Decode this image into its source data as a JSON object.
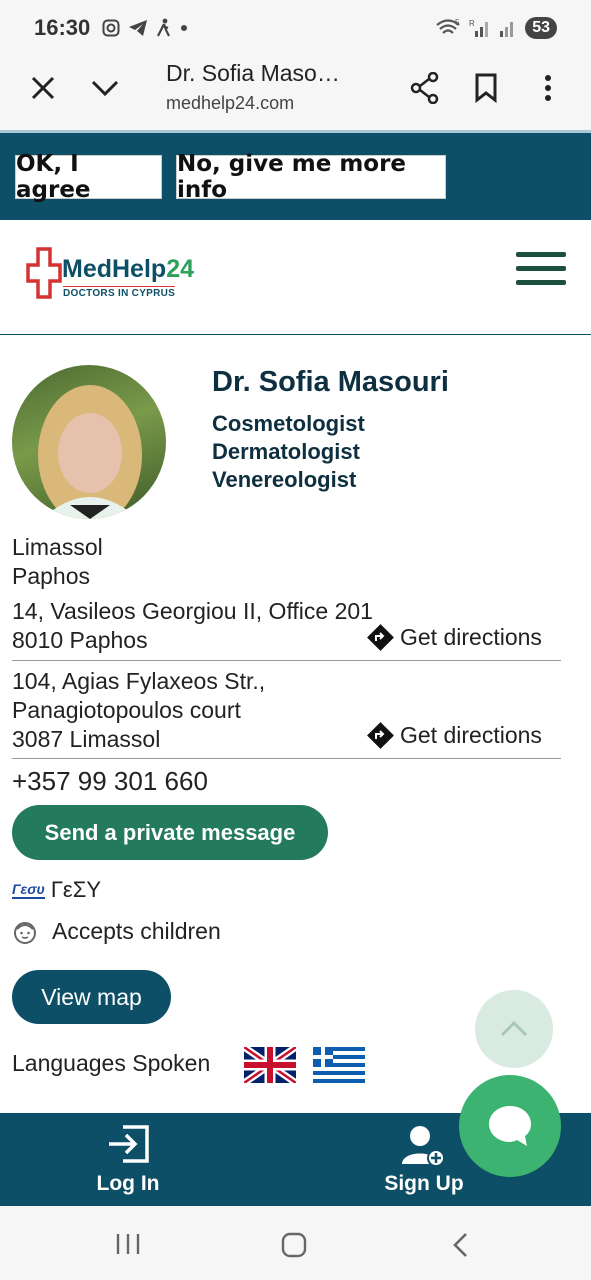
{
  "status_bar": {
    "time": "16:30",
    "battery": "53",
    "sig_5g": "5",
    "sig_r": "R"
  },
  "browser": {
    "title": "Dr. Sofia Maso…",
    "domain": "medhelp24.com"
  },
  "cookie": {
    "agree_label": "OK, I agree",
    "more_info_label": "No, give me more info"
  },
  "logo": {
    "name_part1": "MedHelp",
    "name_part2": "24",
    "tagline": "DOCTORS IN CYPRUS"
  },
  "doctor": {
    "name": "Dr. Sofia Masouri",
    "specialties": [
      "Cosmetologist",
      "Dermatologist",
      "Venereologist"
    ],
    "cities": [
      "Limassol",
      "Paphos"
    ],
    "addresses": [
      {
        "lines": [
          "14, Vasileos Georgiou II, Office 201",
          "8010 Paphos"
        ]
      },
      {
        "lines": [
          "104, Agias Fylaxeos Str.,",
          "Panagiotopoulos court",
          "3087 Limassol"
        ]
      }
    ],
    "directions_label": "Get directions",
    "phone": "+357 99 301 660"
  },
  "actions": {
    "message_label": "Send a private message",
    "gesy_logo_text": "Γεσυ",
    "gesy_label": "ΓεΣΥ",
    "children_label": "Accepts children",
    "map_label": "View map",
    "languages_label": "Languages Spoken"
  },
  "bottom_nav": {
    "login_label": "Log In",
    "signup_label": "Sign Up"
  },
  "colors": {
    "primary": "#0d4f66",
    "green_button": "#237a5c",
    "fab_green": "#3cb371",
    "logo_red": "#d33333"
  }
}
